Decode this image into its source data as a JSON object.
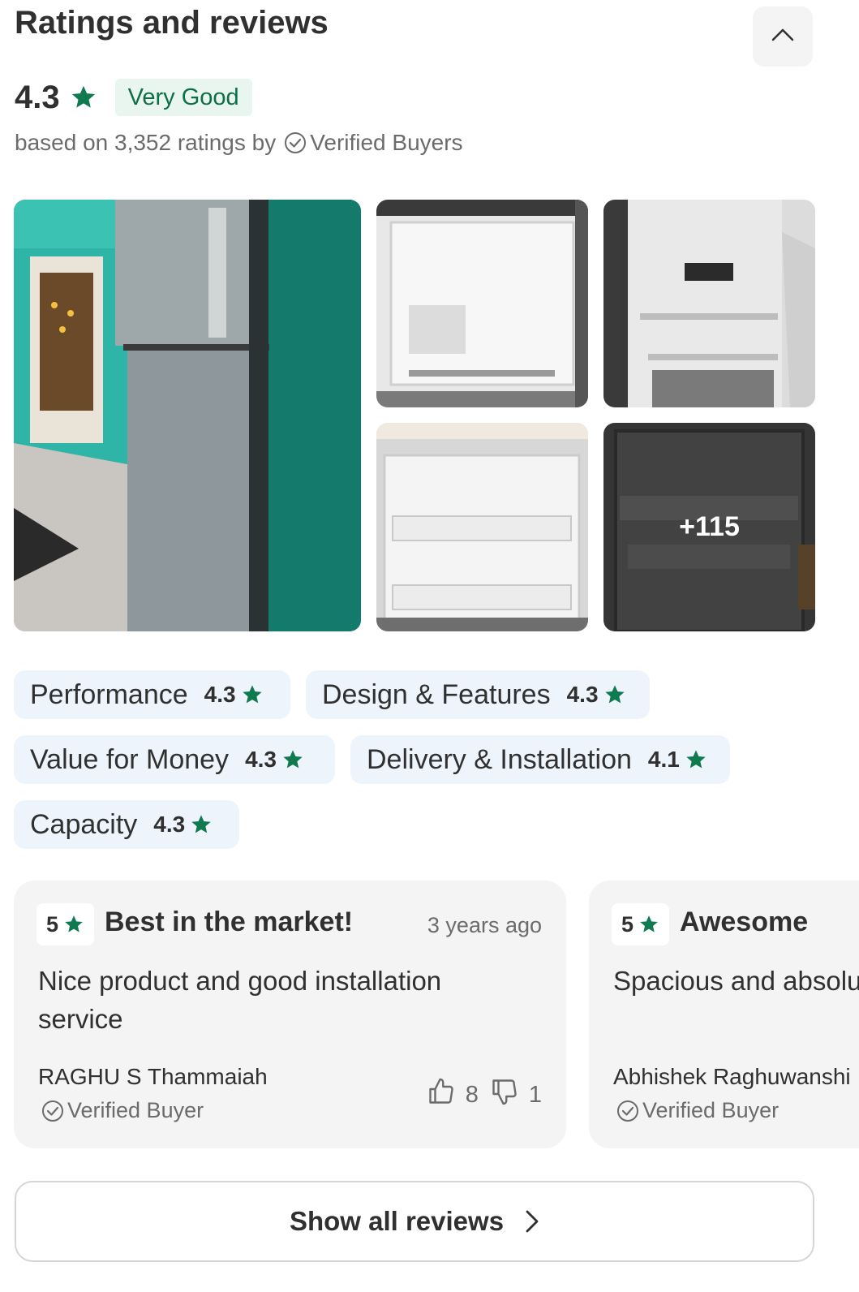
{
  "section": {
    "title": "Ratings and reviews",
    "collapse_icon": "chevron-up-icon"
  },
  "summary": {
    "rating": "4.3",
    "rating_label": "Very Good",
    "based_on_text": "based on 3,352 ratings by",
    "verified_text": "Verified Buyers"
  },
  "photos": {
    "more_count": "+115"
  },
  "aspects": [
    {
      "name": "Performance",
      "score": "4.3"
    },
    {
      "name": "Design & Features",
      "score": "4.3"
    },
    {
      "name": "Value for Money",
      "score": "4.3"
    },
    {
      "name": "Delivery & Installation",
      "score": "4.1"
    },
    {
      "name": "Capacity",
      "score": "4.3"
    }
  ],
  "reviews": [
    {
      "stars": "5",
      "title": "Best in the market!",
      "time": "3 years ago",
      "text": "Nice product and good installation service",
      "author": "RAGHU S Thammaiah",
      "verified": "Verified Buyer",
      "likes": "8",
      "dislikes": "1"
    },
    {
      "stars": "5",
      "title": "Awesome",
      "text": "Spacious  and absolutely",
      "author": "Abhishek Raghuwanshi",
      "verified": "Verified Buyer"
    }
  ],
  "show_all": {
    "label": "Show all reviews"
  },
  "colors": {
    "star_green": "#0f7a4f",
    "badge_bg": "#e8f6ef",
    "aspect_bg": "#eef4fb",
    "card_bg": "#f4f4f4"
  }
}
